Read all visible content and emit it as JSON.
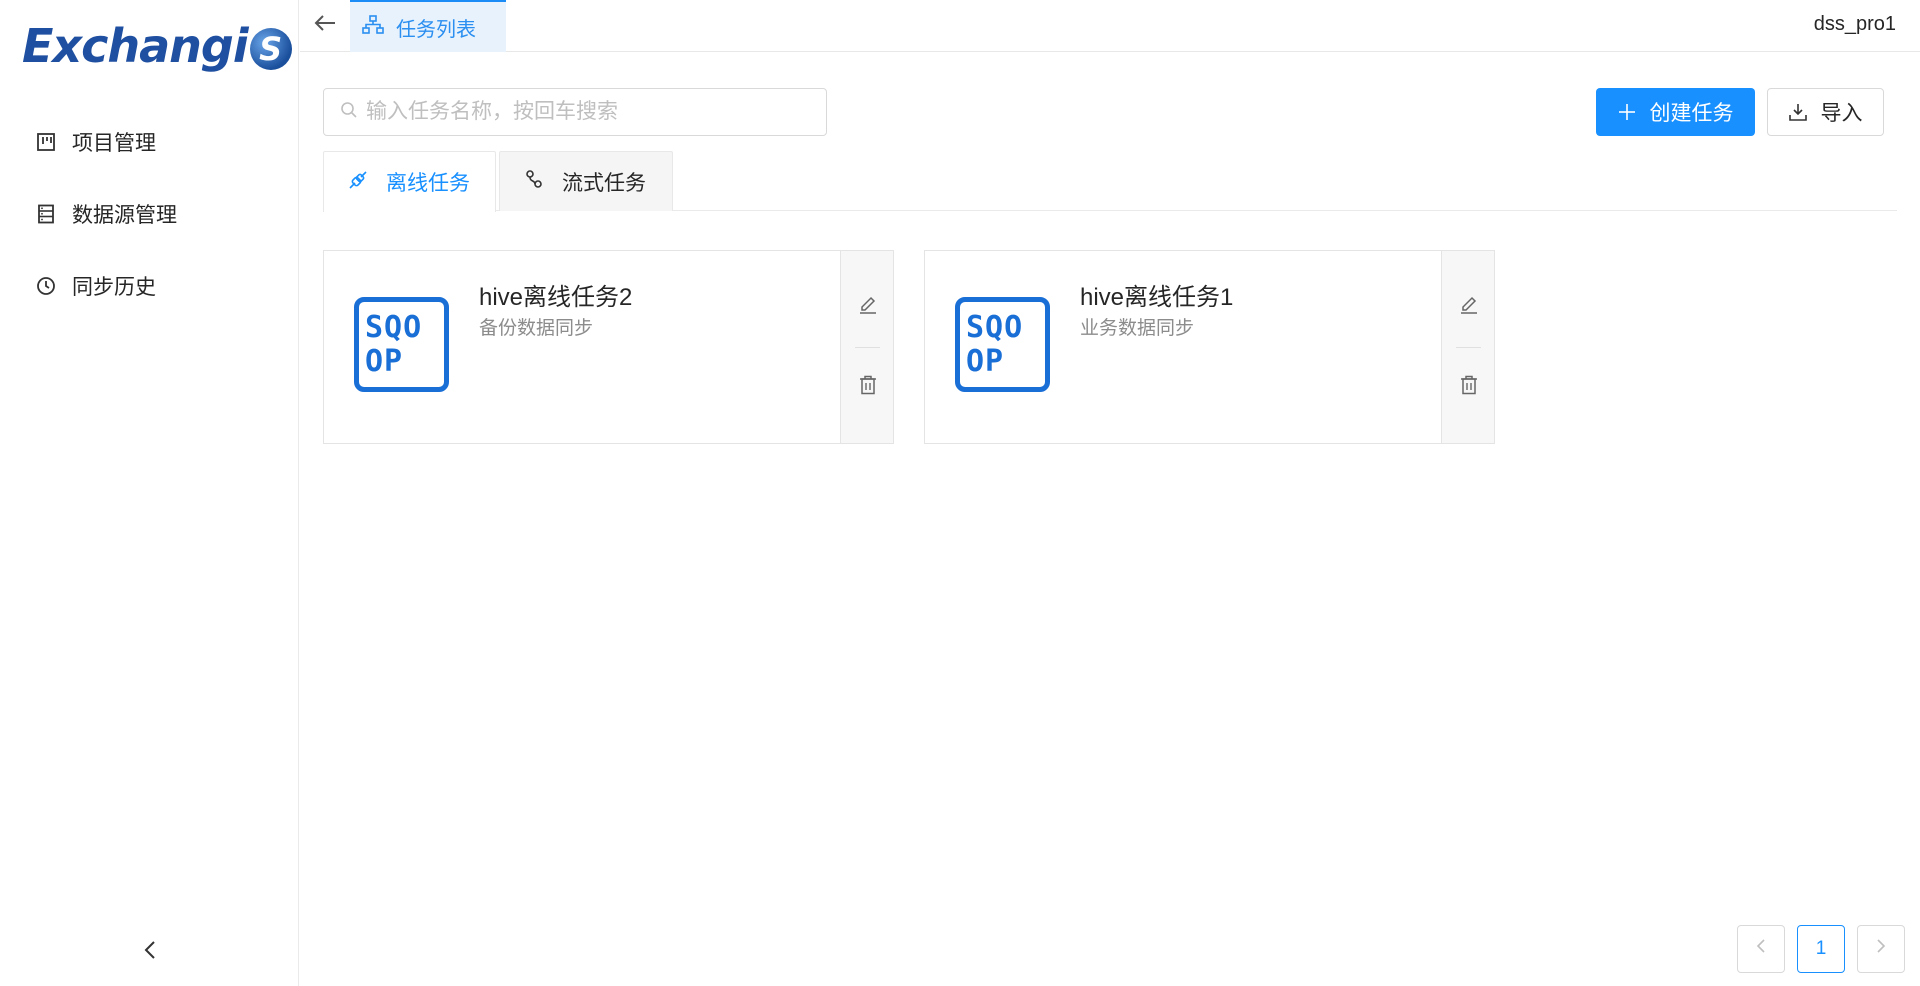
{
  "app": {
    "logo_text": "Exchangi",
    "logo_badge": "S"
  },
  "sidebar": {
    "items": [
      {
        "label": "项目管理",
        "icon": "project-icon"
      },
      {
        "label": "数据源管理",
        "icon": "datasource-icon"
      },
      {
        "label": "同步历史",
        "icon": "history-icon"
      }
    ]
  },
  "header": {
    "tab_label": "任务列表",
    "user": "dss_pro1"
  },
  "toolbar": {
    "search_placeholder": "输入任务名称，按回车搜索",
    "create_label": "创建任务",
    "import_label": "导入"
  },
  "tabs": [
    {
      "label": "离线任务",
      "active": true
    },
    {
      "label": "流式任务",
      "active": false
    }
  ],
  "cards": [
    {
      "title": "hive离线任务2",
      "subtitle": "备份数据同步",
      "logo_line1": "SQO",
      "logo_line2": "OP"
    },
    {
      "title": "hive离线任务1",
      "subtitle": "业务数据同步",
      "logo_line1": "SQO",
      "logo_line2": "OP"
    }
  ],
  "pagination": {
    "current": "1"
  },
  "colors": {
    "primary": "#1890ff",
    "logo": "#1f4fa0",
    "sqoop": "#1a6fd6"
  }
}
